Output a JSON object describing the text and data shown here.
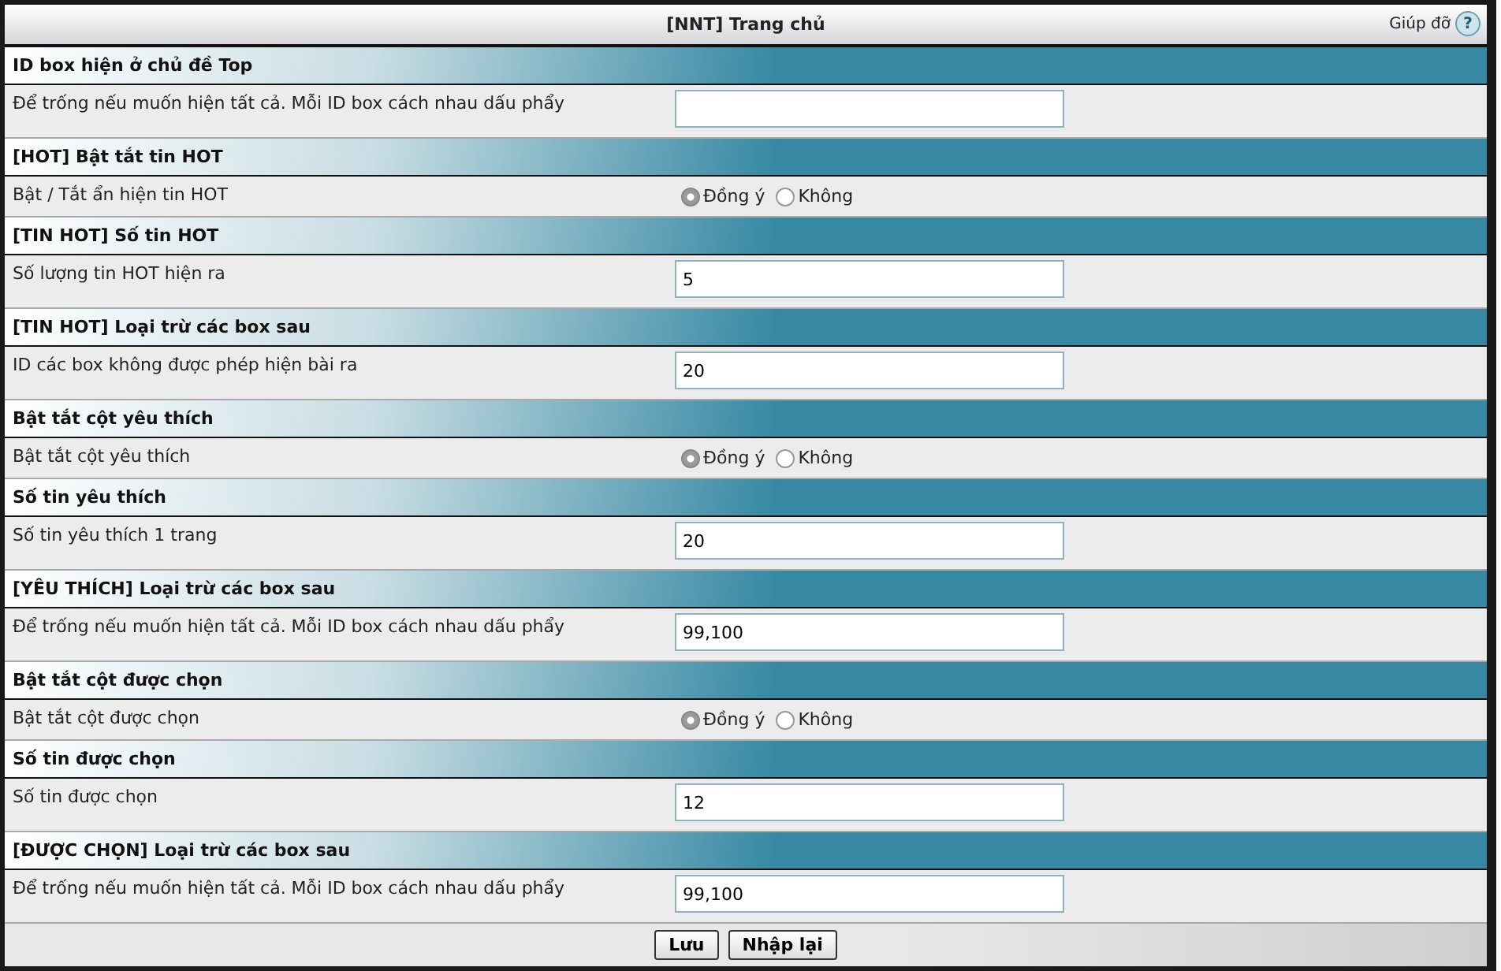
{
  "window": {
    "title": "[NNT] Trang chủ",
    "help": "Giúp đỡ",
    "help_icon": "?"
  },
  "sections": [
    {
      "heading": "ID box hiện ở chủ đề Top",
      "label": "Để trống nếu muốn hiện tất cả. Mỗi ID box cách nhau dấu phẩy",
      "kind": "text"
    },
    {
      "heading": "[HOT] Bật tắt tin HOT",
      "label": "Bật / Tắt ẩn hiện tin HOT",
      "kind": "radio",
      "options": [
        {
          "label": "Đồng ý",
          "selected": true
        },
        {
          "label": "Không",
          "selected": false
        }
      ]
    },
    {
      "heading": "[TIN HOT] Số tin HOT",
      "label": "Số lượng tin HOT hiện ra",
      "kind": "text",
      "value": "5"
    },
    {
      "heading": "[TIN HOT] Loại trừ các box sau",
      "label": "ID các box không được phép hiện bài ra",
      "kind": "text",
      "value": "20"
    },
    {
      "heading": "Bật tắt cột yêu thích",
      "label": "Bật tắt cột yêu thích",
      "kind": "radio",
      "options": [
        {
          "label": "Đồng ý",
          "selected": true
        },
        {
          "label": "Không",
          "selected": false
        }
      ]
    },
    {
      "heading": "Số tin yêu thích",
      "label": "Số tin yêu thích 1 trang",
      "kind": "text",
      "value": "20"
    },
    {
      "heading": "[YÊU THÍCH] Loại trừ các box sau",
      "label": "Để trống nếu muốn hiện tất cả. Mỗi ID box cách nhau dấu phẩy",
      "kind": "text",
      "value": "99,100"
    },
    {
      "heading": "Bật tắt cột được chọn",
      "label": "Bật tắt cột được chọn",
      "kind": "radio",
      "options": [
        {
          "label": "Đồng ý",
          "selected": true
        },
        {
          "label": "Không",
          "selected": false
        }
      ]
    },
    {
      "heading": "Số tin được chọn",
      "label": "Số tin được chọn",
      "kind": "text",
      "value": "12"
    },
    {
      "heading": "[ĐƯỢC CHỌN] Loại trừ các box sau",
      "label": "Để trống nếu muốn hiện tất cả. Mỗi ID box cách nhau dấu phẩy",
      "kind": "text",
      "value": "99,100"
    }
  ],
  "buttons": [
    {
      "label": "Lưu"
    },
    {
      "label": "Nhập lại"
    }
  ]
}
